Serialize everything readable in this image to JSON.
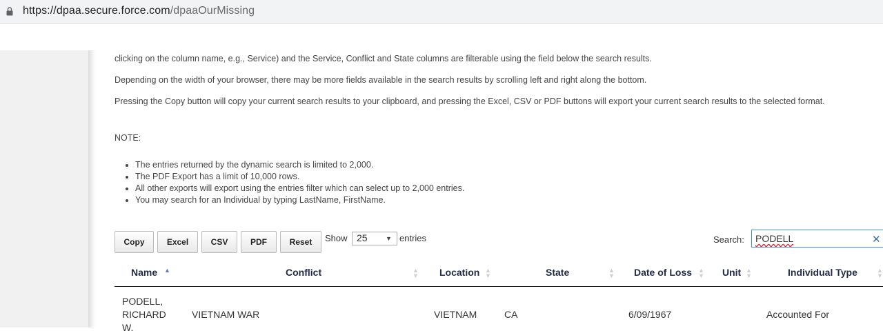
{
  "browser": {
    "url_host": "https://dpaa.secure.force.com",
    "url_path": "/dpaaOurMissing"
  },
  "instructions": {
    "p1": "clicking on the column name, e.g., Service) and the Service, Conflict and State columns are filterable using the field below the search results.",
    "p2": "Depending on the width of your browser, there may be more fields available in the search results by scrolling left and right along the bottom.",
    "p3": "Pressing the Copy button will copy your current search results to your clipboard, and pressing the Excel, CSV or PDF buttons will export your current search results to the selected format.",
    "note_label": "NOTE:",
    "notes": [
      "The entries returned by the dynamic search is limited to 2,000.",
      "The PDF Export has a limit of 10,000 rows.",
      "All other exports will export using the entries filter which can select up to 2,000 entries.",
      "You may search for an Individual by typing LastName, FirstName."
    ]
  },
  "toolbar": {
    "copy": "Copy",
    "excel": "Excel",
    "csv": "CSV",
    "pdf": "PDF",
    "reset": "Reset",
    "show_label": "Show",
    "page_length": "25",
    "entries_label": "entries",
    "search_label": "Search:",
    "search_value": "PODELL"
  },
  "table": {
    "columns": [
      "Name",
      "Conflict",
      "Location",
      "State",
      "Date of Loss",
      "Unit",
      "Individual Type"
    ],
    "rows": [
      {
        "name_lines": [
          "PODELL,",
          "RICHARD",
          "W."
        ],
        "conflict": "VIETNAM WAR",
        "location": "VIETNAM",
        "state": "CA",
        "date_of_loss": "6/09/1967",
        "unit": "",
        "individual_type": "Accounted For"
      }
    ]
  },
  "icons": {
    "lock": "lock-icon",
    "clear": "clear-icon",
    "caret": "chevron-down-icon",
    "sort": "sort-arrows-icon"
  }
}
